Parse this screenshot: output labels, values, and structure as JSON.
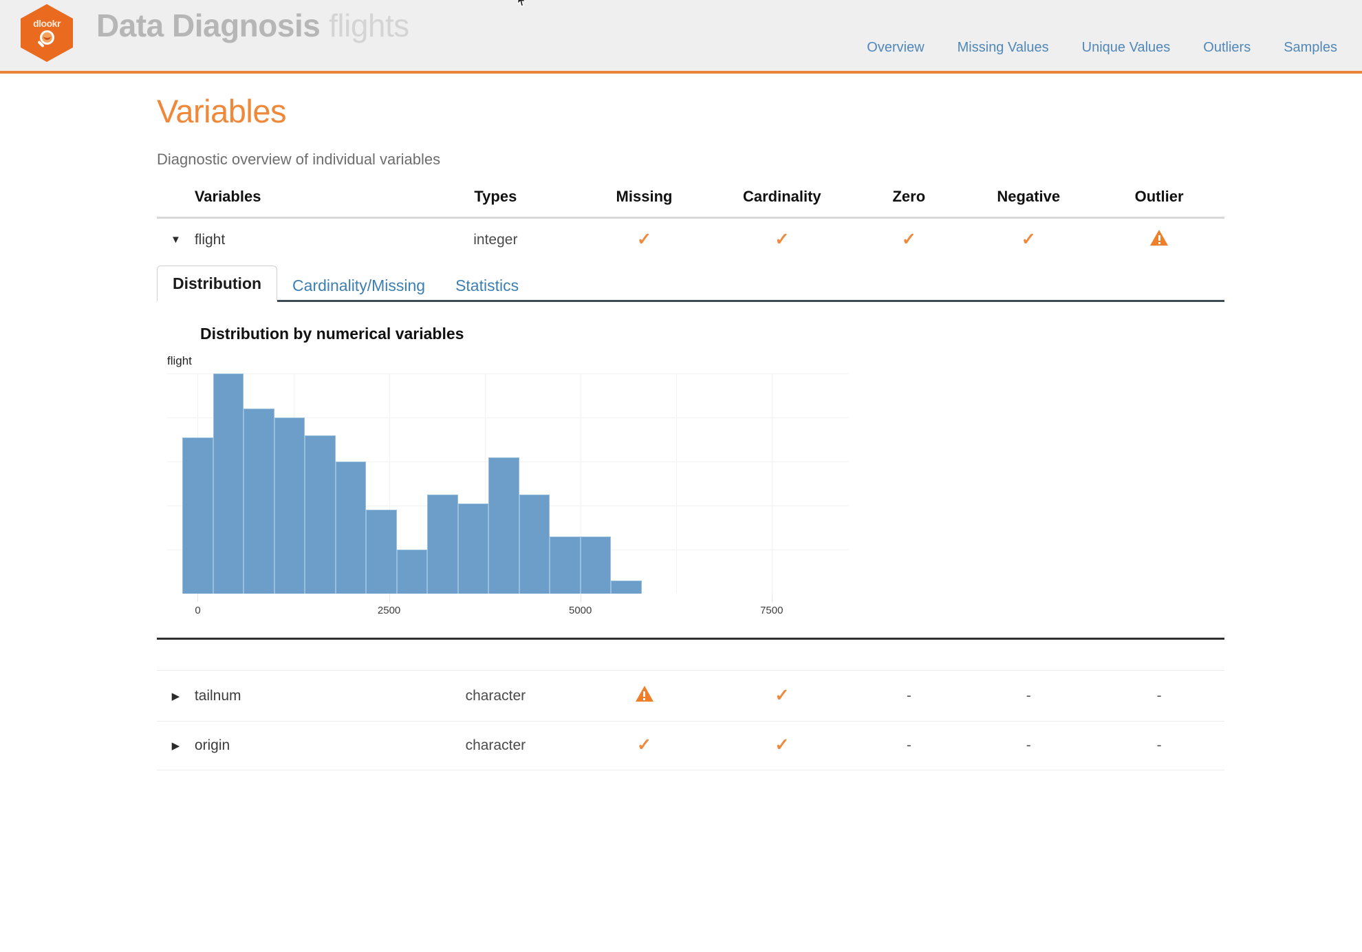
{
  "header": {
    "logo_word": "dlookr",
    "brand_strong": "Data Diagnosis",
    "brand_light": "flights",
    "nav": [
      {
        "label": "Overview"
      },
      {
        "label": "Missing Values"
      },
      {
        "label": "Unique Values"
      },
      {
        "label": "Outliers"
      },
      {
        "label": "Samples"
      }
    ],
    "accent": "#e8843c",
    "nav_color": "#5087b8"
  },
  "page": {
    "title": "Variables",
    "subtitle": "Diagnostic overview of individual variables",
    "title_color": "#f0883a"
  },
  "table": {
    "columns": [
      "Variables",
      "Types",
      "Missing",
      "Cardinality",
      "Zero",
      "Negative",
      "Outlier"
    ],
    "expanded_row": {
      "arrow": "▼",
      "name": "flight",
      "type": "integer",
      "missing": "check",
      "cardinality": "check",
      "zero": "check",
      "negative": "check",
      "outlier": "warning"
    },
    "rows": [
      {
        "arrow": "▶",
        "name": "tailnum",
        "type": "character",
        "missing": "warning",
        "cardinality": "check",
        "zero": "-",
        "negative": "-",
        "outlier": "-"
      },
      {
        "arrow": "▶",
        "name": "origin",
        "type": "character",
        "missing": "check",
        "cardinality": "check",
        "zero": "-",
        "negative": "-",
        "outlier": "-"
      }
    ]
  },
  "tabs": [
    {
      "label": "Distribution",
      "active": true
    },
    {
      "label": "Cardinality/Missing",
      "active": false
    },
    {
      "label": "Statistics",
      "active": false
    }
  ],
  "chart_heading": "Distribution by numerical variables",
  "chart_data": {
    "type": "bar",
    "title": "flight",
    "xlabel": "",
    "ylabel": "",
    "grid": true,
    "legend": "none",
    "bar_color": "#6d9ec9",
    "bar_border_color": "#96bedd",
    "xlim": [
      -400,
      8500
    ],
    "ylim": [
      0,
      100
    ],
    "xticks": [
      0,
      2500,
      5000,
      7500
    ],
    "xtick_labels": [
      "0",
      "2500",
      "5000",
      "7500"
    ],
    "bin_width": 400,
    "bin_starts": [
      -200,
      200,
      600,
      1000,
      1400,
      1800,
      2200,
      2600,
      3000,
      3400,
      3800,
      4200,
      4600,
      5000,
      5400,
      5800
    ],
    "values": [
      71,
      100,
      84,
      80,
      72,
      60,
      38,
      20,
      45,
      41,
      62,
      45,
      26,
      26,
      6,
      0
    ],
    "bins": [
      {
        "x0": -200,
        "x1": 200,
        "count": 71
      },
      {
        "x0": 200,
        "x1": 600,
        "count": 100
      },
      {
        "x0": 600,
        "x1": 1000,
        "count": 84
      },
      {
        "x0": 1000,
        "x1": 1400,
        "count": 80
      },
      {
        "x0": 1400,
        "x1": 1800,
        "count": 72
      },
      {
        "x0": 1800,
        "x1": 2200,
        "count": 60
      },
      {
        "x0": 2200,
        "x1": 2600,
        "count": 38
      },
      {
        "x0": 2600,
        "x1": 3000,
        "count": 20
      },
      {
        "x0": 3000,
        "x1": 3400,
        "count": 45
      },
      {
        "x0": 3400,
        "x1": 3800,
        "count": 41
      },
      {
        "x0": 3800,
        "x1": 4200,
        "count": 62
      },
      {
        "x0": 4200,
        "x1": 4600,
        "count": 45
      },
      {
        "x0": 4600,
        "x1": 5000,
        "count": 26
      },
      {
        "x0": 5000,
        "x1": 5400,
        "count": 26
      },
      {
        "x0": 5400,
        "x1": 5800,
        "count": 6
      }
    ]
  }
}
